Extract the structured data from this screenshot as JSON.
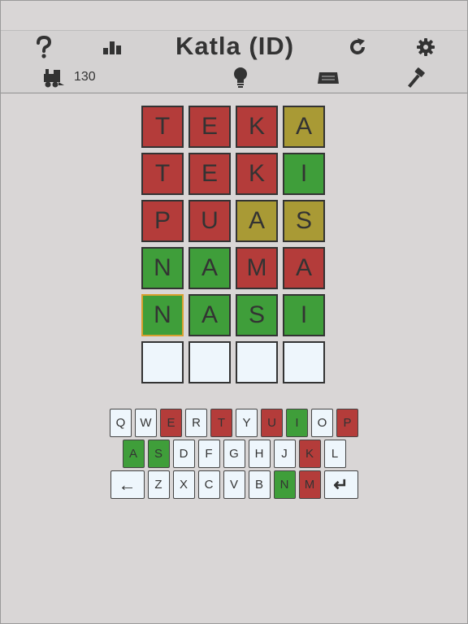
{
  "header": {
    "title": "Katla (ID)",
    "icons": [
      "help-icon",
      "stats-icon",
      "refresh-icon",
      "settings-icon"
    ]
  },
  "subbar": {
    "streak_count": "130",
    "icons": [
      "locomotive-icon",
      "lightbulb-icon",
      "keyboard-icon",
      "hammer-icon"
    ]
  },
  "colors": {
    "red": "#b43c3a",
    "yellow": "#a99a35",
    "green": "#3f9e3a",
    "empty": "#eef6fc",
    "active_border": "#d9a030"
  },
  "board": [
    [
      {
        "l": "T",
        "s": "red"
      },
      {
        "l": "E",
        "s": "red"
      },
      {
        "l": "K",
        "s": "red"
      },
      {
        "l": "A",
        "s": "yellow"
      }
    ],
    [
      {
        "l": "T",
        "s": "red"
      },
      {
        "l": "E",
        "s": "red"
      },
      {
        "l": "K",
        "s": "red"
      },
      {
        "l": "I",
        "s": "green"
      }
    ],
    [
      {
        "l": "P",
        "s": "red"
      },
      {
        "l": "U",
        "s": "red"
      },
      {
        "l": "A",
        "s": "yellow"
      },
      {
        "l": "S",
        "s": "yellow"
      }
    ],
    [
      {
        "l": "N",
        "s": "green"
      },
      {
        "l": "A",
        "s": "green"
      },
      {
        "l": "M",
        "s": "red"
      },
      {
        "l": "A",
        "s": "red"
      }
    ],
    [
      {
        "l": "N",
        "s": "green",
        "active": true
      },
      {
        "l": "A",
        "s": "green"
      },
      {
        "l": "S",
        "s": "green"
      },
      {
        "l": "I",
        "s": "green"
      }
    ],
    [
      {
        "l": "",
        "s": "empty"
      },
      {
        "l": "",
        "s": "empty"
      },
      {
        "l": "",
        "s": "empty"
      },
      {
        "l": "",
        "s": "empty"
      }
    ]
  ],
  "keyboard": [
    [
      {
        "k": "Q"
      },
      {
        "k": "W"
      },
      {
        "k": "E",
        "s": "red"
      },
      {
        "k": "R"
      },
      {
        "k": "T",
        "s": "red"
      },
      {
        "k": "Y"
      },
      {
        "k": "U",
        "s": "red"
      },
      {
        "k": "I",
        "s": "green"
      },
      {
        "k": "O"
      },
      {
        "k": "P",
        "s": "red"
      }
    ],
    [
      {
        "k": "A",
        "s": "green"
      },
      {
        "k": "S",
        "s": "green"
      },
      {
        "k": "D"
      },
      {
        "k": "F"
      },
      {
        "k": "G"
      },
      {
        "k": "H"
      },
      {
        "k": "J"
      },
      {
        "k": "K",
        "s": "red"
      },
      {
        "k": "L"
      }
    ],
    [
      {
        "k": "←",
        "wide": true,
        "name": "backspace"
      },
      {
        "k": "Z"
      },
      {
        "k": "X"
      },
      {
        "k": "C"
      },
      {
        "k": "V"
      },
      {
        "k": "B"
      },
      {
        "k": "N",
        "s": "green"
      },
      {
        "k": "M",
        "s": "red"
      },
      {
        "k": "↵",
        "wide": true,
        "name": "enter"
      }
    ]
  ]
}
